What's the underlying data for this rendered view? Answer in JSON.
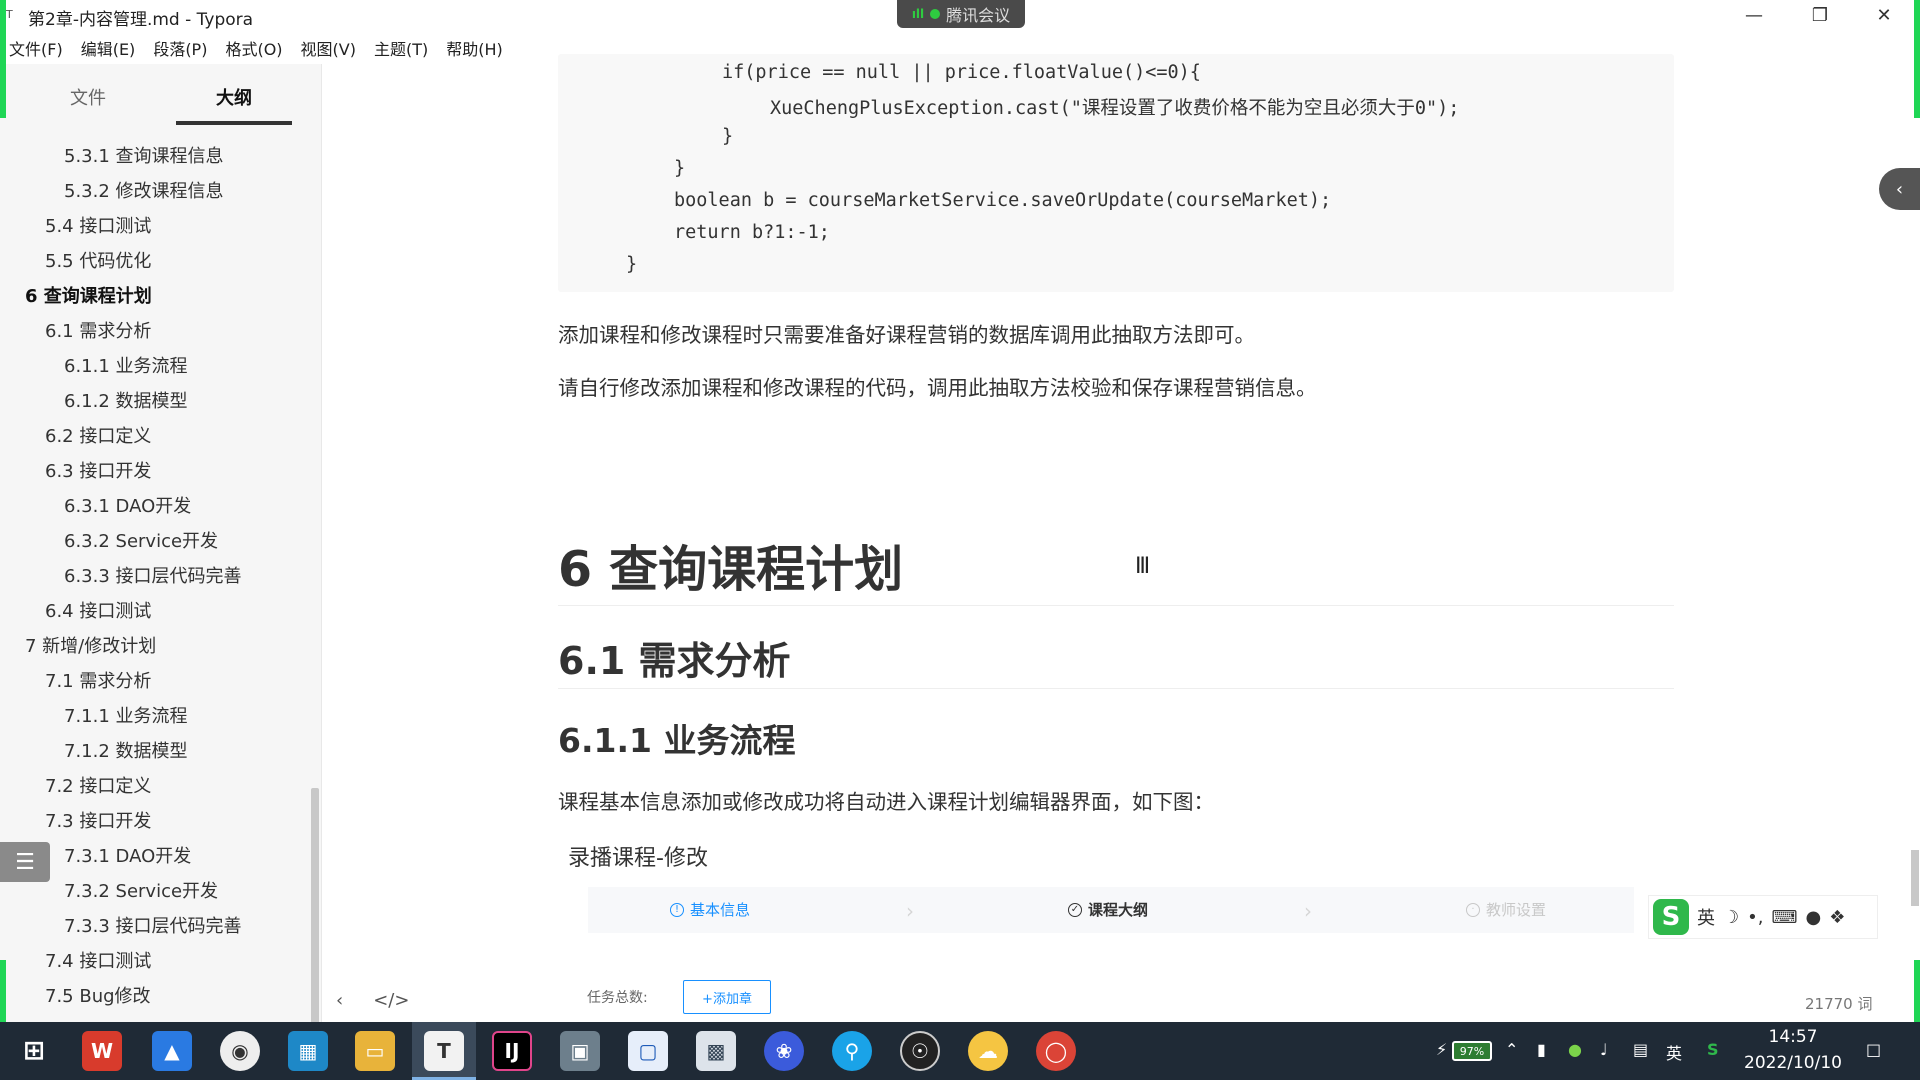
{
  "window": {
    "icon": "T",
    "title": "第2章-内容管理.md - Typora",
    "meeting": "腾讯会议",
    "meeting_signal": "ıll"
  },
  "menu": [
    "文件(F)",
    "编辑(E)",
    "段落(P)",
    "格式(O)",
    "视图(V)",
    "主题(T)",
    "帮助(H)"
  ],
  "sidebar": {
    "tabs": {
      "files": "文件",
      "outline": "大纲"
    },
    "outline": [
      {
        "label": "5.3.1 查询课程信息",
        "level": 3
      },
      {
        "label": "5.3.2 修改课程信息",
        "level": 3
      },
      {
        "label": "5.4 接口测试",
        "level": 2
      },
      {
        "label": "5.5 代码优化",
        "level": 2
      },
      {
        "label": "6 查询课程计划",
        "level": 1,
        "active": true
      },
      {
        "label": "6.1 需求分析",
        "level": 2
      },
      {
        "label": "6.1.1 业务流程",
        "level": 3
      },
      {
        "label": "6.1.2 数据模型",
        "level": 3
      },
      {
        "label": "6.2 接口定义",
        "level": 2
      },
      {
        "label": "6.3 接口开发",
        "level": 2
      },
      {
        "label": "6.3.1 DAO开发",
        "level": 3
      },
      {
        "label": "6.3.2 Service开发",
        "level": 3
      },
      {
        "label": "6.3.3 接口层代码完善",
        "level": 3
      },
      {
        "label": "6.4 接口测试",
        "level": 2
      },
      {
        "label": "7 新增/修改计划",
        "level": 1
      },
      {
        "label": "7.1 需求分析",
        "level": 2
      },
      {
        "label": "7.1.1 业务流程",
        "level": 3
      },
      {
        "label": "7.1.2 数据模型",
        "level": 3
      },
      {
        "label": "7.2 接口定义",
        "level": 2
      },
      {
        "label": "7.3 接口开发",
        "level": 2
      },
      {
        "label": "7.3.1 DAO开发",
        "level": 3
      },
      {
        "label": "7.3.2 Service开发",
        "level": 3
      },
      {
        "label": "7.3.3 接口层代码完善",
        "level": 3
      },
      {
        "label": "7.4 接口测试",
        "level": 2
      },
      {
        "label": "7.5 Bug修改",
        "level": 2
      }
    ]
  },
  "code": [
    "if(price == null || price.floatValue()<=0){",
    "XueChengPlusException.cast(\"课程设置了收费价格不能为空且必须大于0\");",
    "}",
    "}",
    "boolean b = courseMarketService.saveOrUpdate(courseMarket);",
    "return b?1:-1;",
    "}"
  ],
  "content": {
    "p1": "添加课程和修改课程时只需要准备好课程营销的数据库调用此抽取方法即可。",
    "p2": "请自行修改添加课程和修改课程的代码，调用此抽取方法校验和保存课程营销信息。",
    "h1": "6 查询课程计划",
    "h2": "6.1 需求分析",
    "h3": "6.1.1 业务流程",
    "p3": "课程基本信息添加或修改成功将自动进入课程计划编辑器界面，如下图：",
    "embed_title": "录播课程-修改",
    "steps": [
      {
        "label": "基本信息",
        "color": "#1890ff"
      },
      {
        "label": "课程大纲",
        "color": "#333333"
      },
      {
        "label": "教师设置",
        "color": "#c8c8c8"
      }
    ],
    "task_label": "任务总数:",
    "add_chapter": "+添加章"
  },
  "status": {
    "word_count": "21770 词"
  },
  "ime": {
    "lang": "英"
  },
  "taskbar": {
    "battery": "97%",
    "ime_lang": "英",
    "time": "14:57",
    "date": "2022/10/10"
  }
}
